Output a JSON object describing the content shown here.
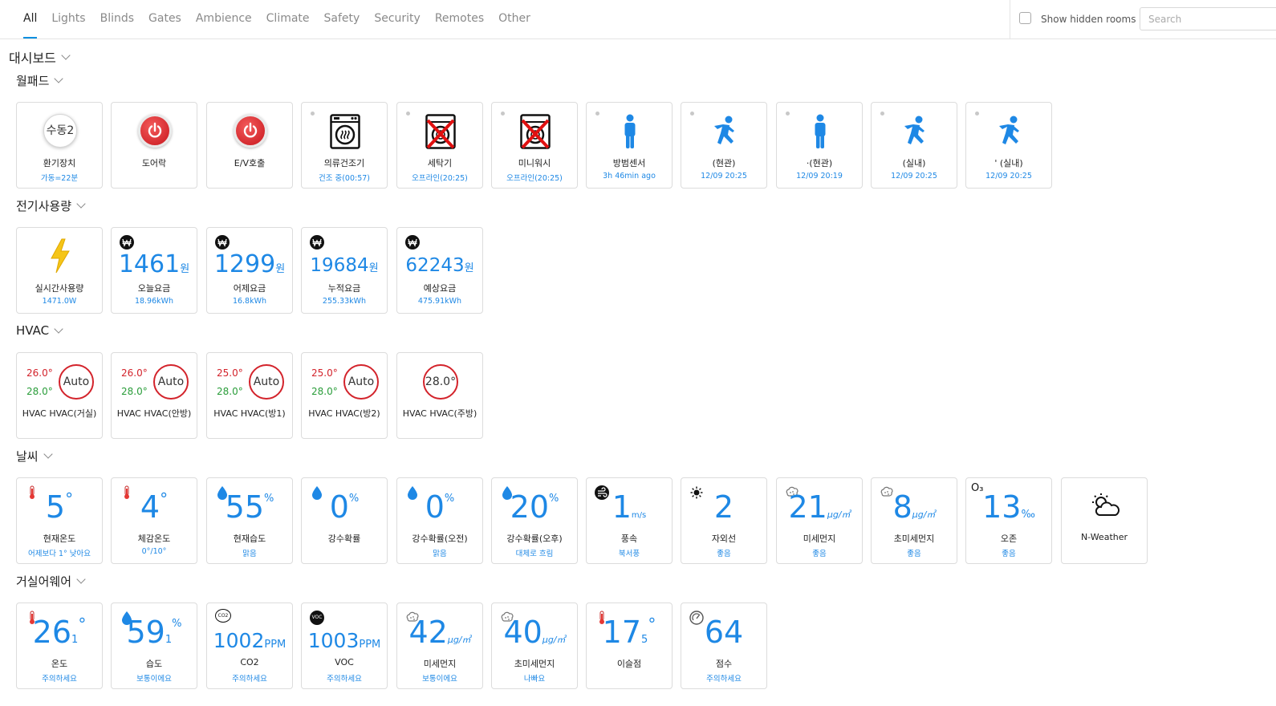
{
  "tabs": [
    {
      "label": "All",
      "active": true
    },
    {
      "label": "Lights"
    },
    {
      "label": "Blinds"
    },
    {
      "label": "Gates"
    },
    {
      "label": "Ambience"
    },
    {
      "label": "Climate"
    },
    {
      "label": "Safety"
    },
    {
      "label": "Security"
    },
    {
      "label": "Remotes"
    },
    {
      "label": "Other"
    }
  ],
  "topbar": {
    "show_hidden_label": "Show hidden rooms",
    "search_placeholder": "Search"
  },
  "dashboard_title": "대시보드",
  "sections": {
    "wallpad": {
      "title": "월패드",
      "cards": [
        {
          "name": "환기장치",
          "sub": "가동=22분",
          "icon_text": "수동2"
        },
        {
          "name": "도어락",
          "sub": ""
        },
        {
          "name": "E/V호출",
          "sub": ""
        },
        {
          "name": "의류건조기",
          "sub": "건조 중(00:57)"
        },
        {
          "name": "세탁기",
          "sub": "오프라인(20:25)"
        },
        {
          "name": "미니워시",
          "sub": "오프라인(20:25)"
        },
        {
          "name": "방범센서",
          "sub": "3h 46min ago"
        },
        {
          "name": "(현관)",
          "sub": "12/09 20:25"
        },
        {
          "name": "·(현관)",
          "sub": "12/09 20:19"
        },
        {
          "name": "(실내)",
          "sub": "12/09 20:25"
        },
        {
          "name": "' (실내)",
          "sub": "12/09 20:25"
        }
      ]
    },
    "power": {
      "title": "전기사용량",
      "cards": [
        {
          "name": "실시간사용량",
          "sub": "1471.0W"
        },
        {
          "value": "1461",
          "unit": "원",
          "name": "오늘요금",
          "sub": "18.96kWh"
        },
        {
          "value": "1299",
          "unit": "원",
          "name": "어제요금",
          "sub": "16.8kWh"
        },
        {
          "value": "19684",
          "unit": "원",
          "name": "누적요금",
          "sub": "255.33kWh"
        },
        {
          "value": "62243",
          "unit": "원",
          "name": "예상요금",
          "sub": "475.91kWh"
        }
      ]
    },
    "hvac": {
      "title": "HVAC",
      "cards": [
        {
          "t1": "26.0°",
          "t2": "28.0°",
          "mode": "Auto",
          "name": "HVAC HVAC(거실)"
        },
        {
          "t1": "26.0°",
          "t2": "28.0°",
          "mode": "Auto",
          "name": "HVAC HVAC(안방)"
        },
        {
          "t1": "25.0°",
          "t2": "28.0°",
          "mode": "Auto",
          "name": "HVAC HVAC(방1)"
        },
        {
          "t1": "25.0°",
          "t2": "28.0°",
          "mode": "Auto",
          "name": "HVAC HVAC(방2)"
        },
        {
          "mode": "28.0°",
          "name": "HVAC HVAC(주방)"
        }
      ]
    },
    "weather": {
      "title": "날씨",
      "cards": [
        {
          "value": "5",
          "unit": "°",
          "name": "현재온도",
          "sub": "어제보다 1° 낮아요"
        },
        {
          "value": "4",
          "unit": "°",
          "name": "체감온도",
          "sub": "0°/10°"
        },
        {
          "value": "55",
          "unit": "%",
          "name": "현재습도",
          "sub": "맑음"
        },
        {
          "value": "0",
          "unit": "%",
          "name": "강수확률",
          "sub": ""
        },
        {
          "value": "0",
          "unit": "%",
          "name": "강수확률(오전)",
          "sub": "맑음"
        },
        {
          "value": "20",
          "unit": "%",
          "name": "강수확률(오후)",
          "sub": "대체로 흐림"
        },
        {
          "value": "1",
          "unit": "m/s",
          "name": "풍속",
          "sub": "북서풍"
        },
        {
          "value": "2",
          "unit": "",
          "name": "자외선",
          "sub": "좋음"
        },
        {
          "value": "21",
          "unit": "μg/㎥",
          "name": "미세먼지",
          "sub": "좋음"
        },
        {
          "value": "8",
          "unit": "μg/㎥",
          "name": "초미세먼지",
          "sub": "좋음"
        },
        {
          "value": "13",
          "unit": "‰",
          "name": "오존",
          "sub": "좋음",
          "icon_text": "O₃"
        },
        {
          "name": "N-Weather",
          "sub": ""
        }
      ]
    },
    "aware": {
      "title": "거실어웨어",
      "cards": [
        {
          "value": "26",
          "small": "1",
          "unit": "°",
          "name": "온도",
          "sub": "주의하세요"
        },
        {
          "value": "59",
          "small": "1",
          "unit": "%",
          "name": "습도",
          "sub": "보통이에요"
        },
        {
          "value": "1002",
          "unit": "PPM",
          "name": "CO2",
          "sub": "주의하세요",
          "icon_text": "CO2"
        },
        {
          "value": "1003",
          "unit": "PPM",
          "name": "VOC",
          "sub": "주의하세요",
          "icon_text": "VOC"
        },
        {
          "value": "42",
          "unit": "μg/㎥",
          "name": "미세먼지",
          "sub": "보통이에요"
        },
        {
          "value": "40",
          "unit": "μg/㎥",
          "name": "초미세먼지",
          "sub": "나빠요"
        },
        {
          "value": "17",
          "small": "5",
          "unit": "°",
          "name": "이슬점",
          "sub": ""
        },
        {
          "value": "64",
          "unit": "",
          "name": "점수",
          "sub": "주의하세요"
        }
      ]
    }
  },
  "colors": {
    "accent": "#1e88e5",
    "hot": "#d3232b",
    "cool": "#2a9d3a"
  }
}
